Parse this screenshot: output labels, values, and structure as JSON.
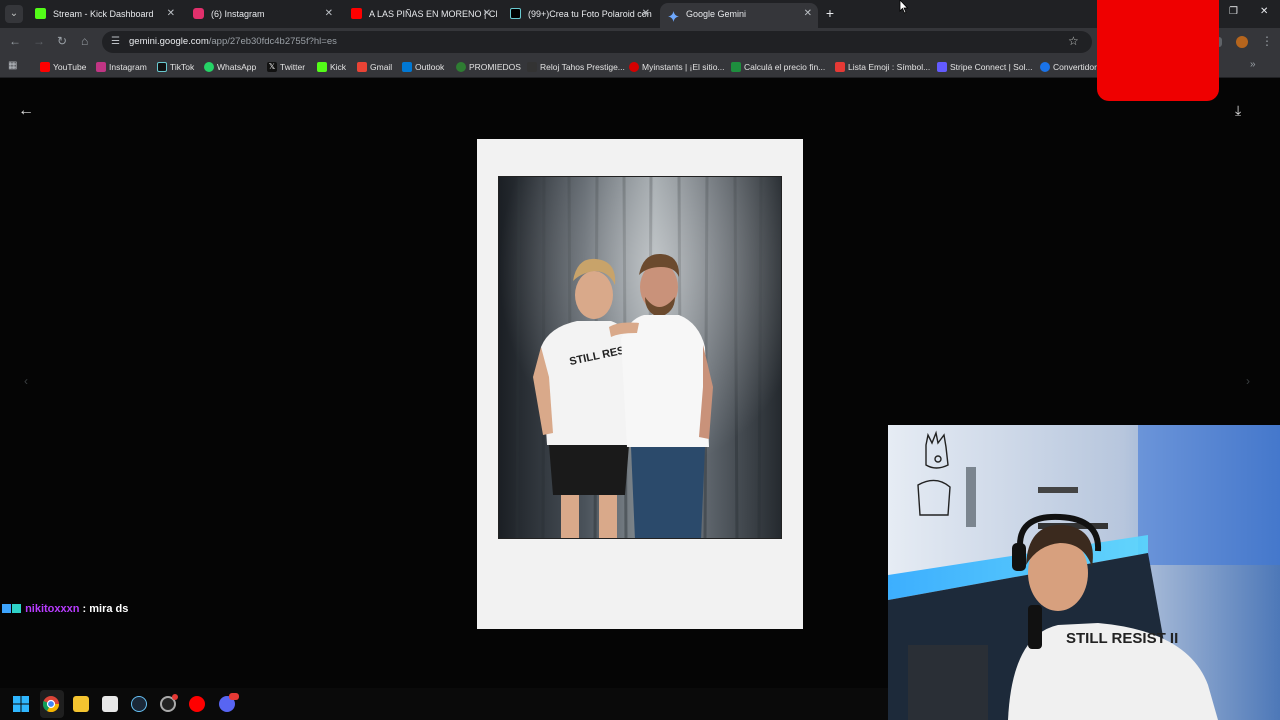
{
  "browser": {
    "tabs": [
      {
        "label": "Stream - Kick Dashboard",
        "icon": "kick-icon",
        "color": "#53fc18"
      },
      {
        "label": "(6) Instagram",
        "icon": "instagram-icon",
        "color": "#e1306c"
      },
      {
        "label": "A LAS PIÑAS EN MORENO | CI",
        "icon": "youtube-icon",
        "color": "#ff0000"
      },
      {
        "label": "(99+)Crea tu Foto Polaroid con",
        "icon": "tiktok-icon",
        "color": "#000000"
      },
      {
        "label": "Google Gemini",
        "icon": "gemini-icon",
        "color": "#4285f4"
      }
    ],
    "url_host": "gemini.google.com",
    "url_path": "/app/27eb30fdc4b2755f?hl=es",
    "bookmarks": [
      {
        "label": "YouTube",
        "icon": "youtube-icon",
        "color": "#ff0000"
      },
      {
        "label": "Instagram",
        "icon": "instagram-icon",
        "color": "#c13584"
      },
      {
        "label": "TikTok",
        "icon": "tiktok-icon",
        "color": "#111111"
      },
      {
        "label": "WhatsApp",
        "icon": "whatsapp-icon",
        "color": "#25d366"
      },
      {
        "label": "Twitter",
        "icon": "x-icon",
        "color": "#111111"
      },
      {
        "label": "Kick",
        "icon": "kick-icon",
        "color": "#53fc18"
      },
      {
        "label": "Gmail",
        "icon": "gmail-icon",
        "color": "#ea4335"
      },
      {
        "label": "Outlook",
        "icon": "outlook-icon",
        "color": "#0078d4"
      },
      {
        "label": "PROMIEDOS",
        "icon": "promiedos-icon",
        "color": "#2e7d32"
      },
      {
        "label": "Reloj Tahos Prestige...",
        "icon": "clock-icon",
        "color": "#333333"
      },
      {
        "label": "Myinstants | ¡El sitio...",
        "icon": "button-icon",
        "color": "#d50000"
      },
      {
        "label": "Calculá el precio fin...",
        "icon": "calculator-icon",
        "color": "#1e8e3e"
      },
      {
        "label": "Lista Emoji : Símbol...",
        "icon": "emoji-icon",
        "color": "#e53935"
      },
      {
        "label": "Stripe Connect | Sol...",
        "icon": "stripe-icon",
        "color": "#635bff"
      },
      {
        "label": "Convertidor",
        "icon": "converter-icon",
        "color": "#1a73e8"
      }
    ]
  },
  "chat": {
    "username": "nikitoxxxn",
    "separator": " : ",
    "message": "mira ds"
  },
  "photo": {
    "shirt_text": "STILL RESIST"
  },
  "webcam": {
    "shirt_text": "STILL RESIST II"
  }
}
